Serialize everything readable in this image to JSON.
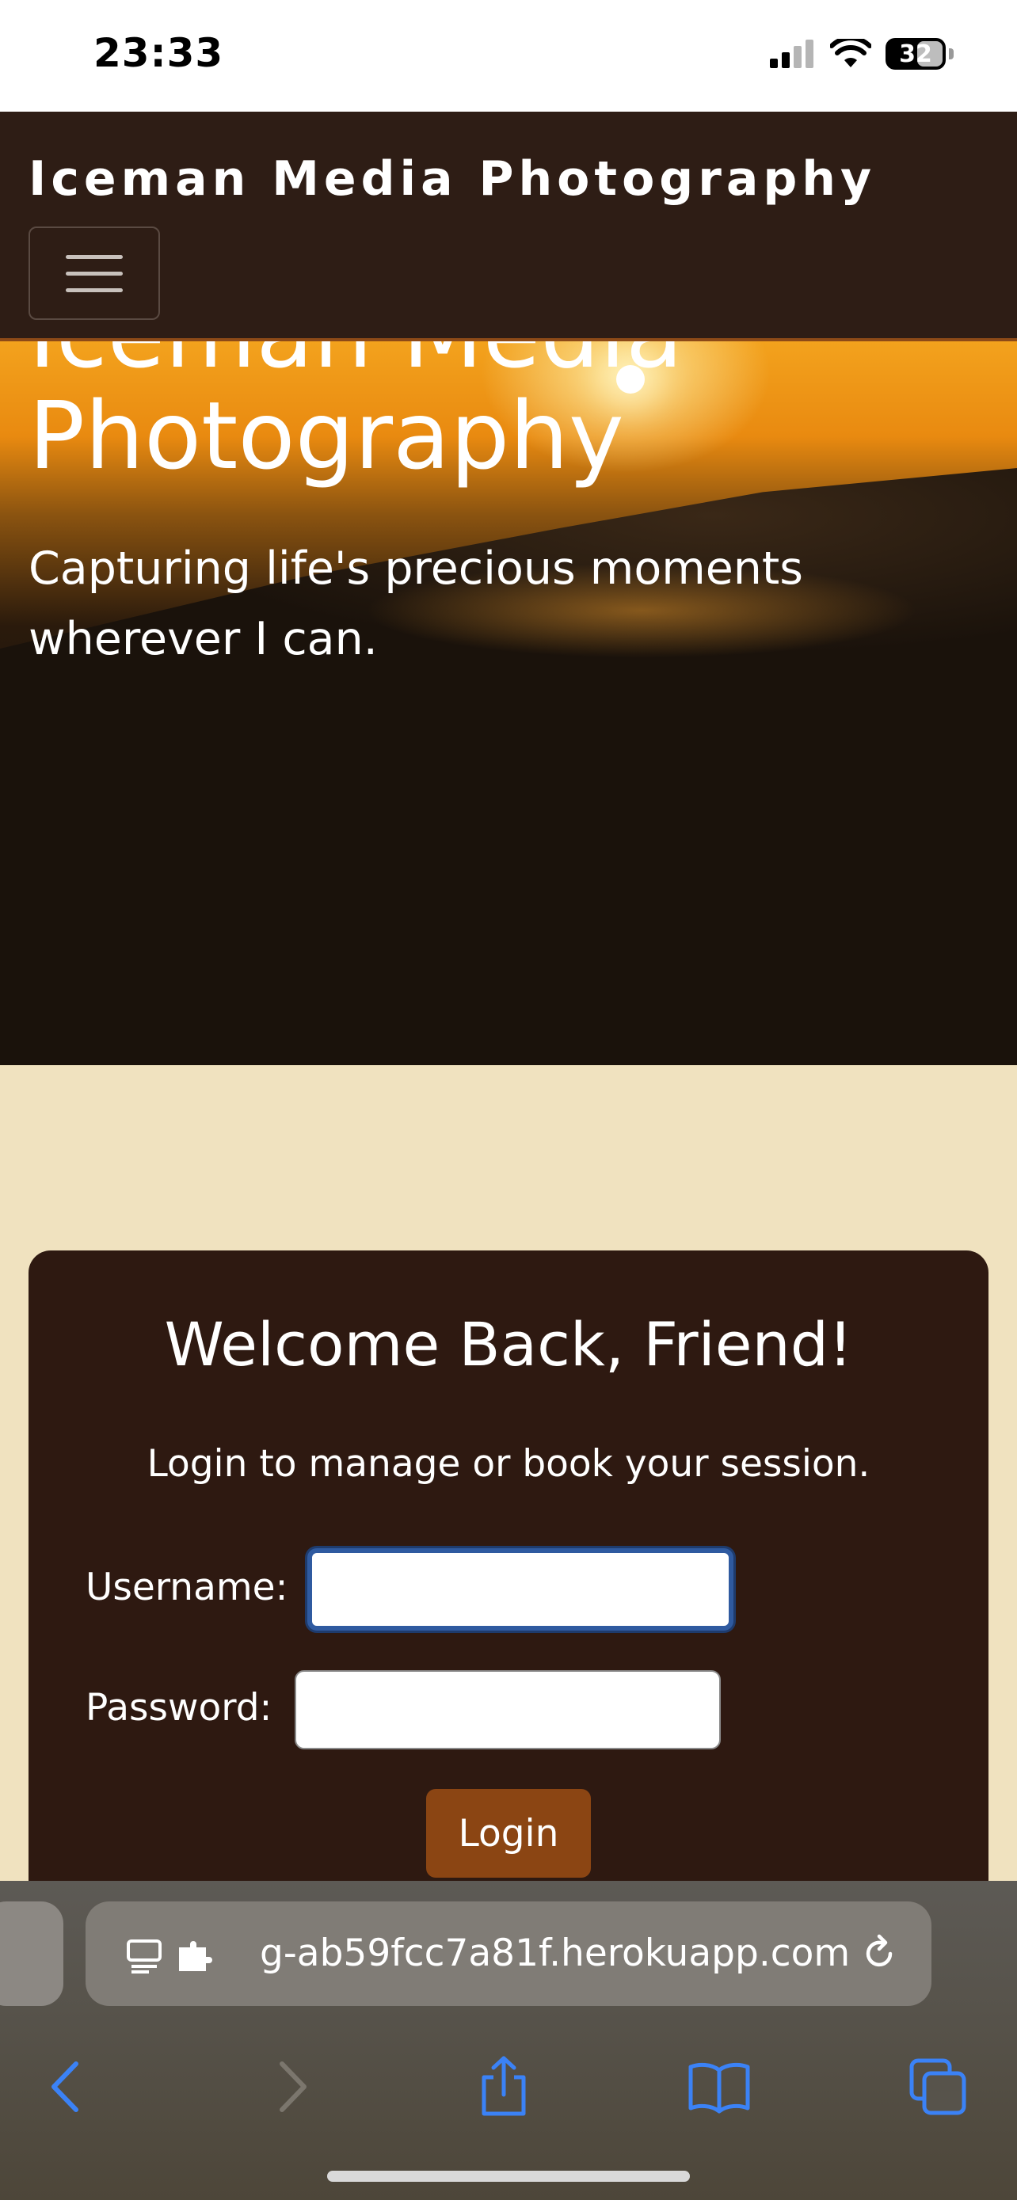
{
  "status_bar": {
    "time": "23:33",
    "battery_level": "32"
  },
  "navbar": {
    "brand": "Iceman Media Photography",
    "menu_icon": "hamburger-icon"
  },
  "hero": {
    "title_line1": "Iceman Media",
    "title_line2": "Photography",
    "subtitle": "Capturing life's precious moments wherever I can."
  },
  "login_card": {
    "title": "Welcome Back, Friend!",
    "subtitle": "Login to manage or book your session.",
    "username_label": "Username:",
    "username_value": "",
    "password_label": "Password:",
    "password_value": "",
    "login_button": "Login"
  },
  "browser": {
    "url": "g-ab59fcc7a81f.herokuapp.com",
    "icons": [
      "page-menu-icon",
      "extension-icon",
      "reload-icon",
      "back-icon",
      "forward-icon",
      "share-icon",
      "bookmarks-icon",
      "tabs-icon"
    ]
  },
  "colors": {
    "navbar_bg": "#2e1d15",
    "page_bg": "#f0e2bf",
    "card_bg": "#2e1911",
    "button_bg": "#8b4513",
    "link_blue": "#3b82f6"
  }
}
